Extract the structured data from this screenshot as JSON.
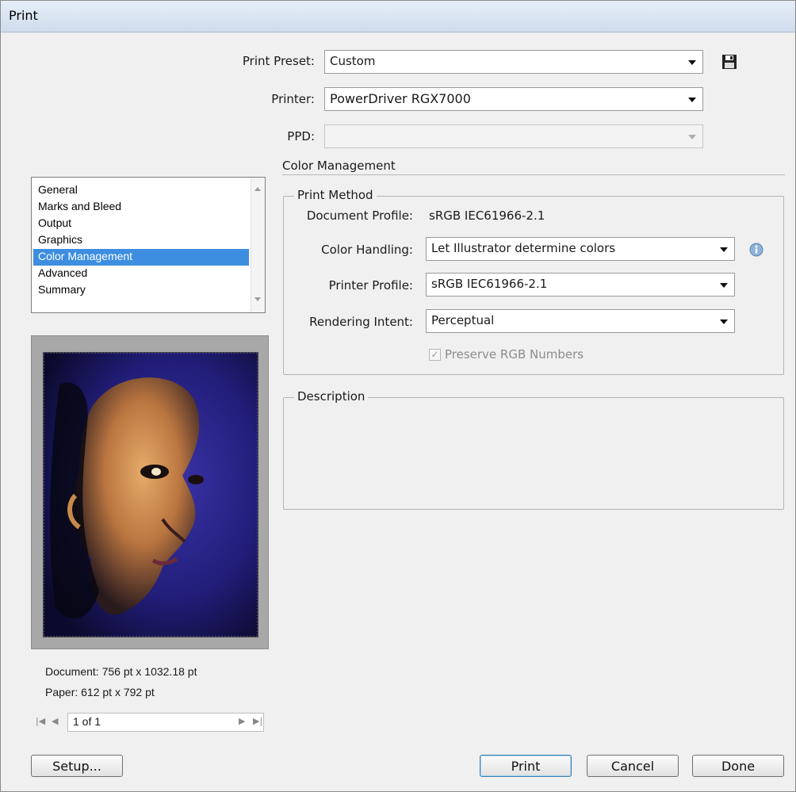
{
  "window": {
    "title": "Print"
  },
  "preset": {
    "label": "Print Preset:",
    "value": "Custom"
  },
  "printer": {
    "label": "Printer:",
    "value": "PowerDriver RGX7000"
  },
  "ppd": {
    "label": "PPD:",
    "value": ""
  },
  "section": {
    "title": "Color Management"
  },
  "print_method": {
    "legend": "Print Method",
    "doc_profile_label": "Document Profile:",
    "doc_profile_value": "sRGB IEC61966-2.1",
    "color_handling_label": "Color Handling:",
    "color_handling_value": "Let Illustrator determine colors",
    "printer_profile_label": "Printer Profile:",
    "printer_profile_value": "sRGB IEC61966-2.1",
    "rendering_intent_label": "Rendering Intent:",
    "rendering_intent_value": "Perceptual",
    "preserve_rgb_label": "Preserve RGB Numbers",
    "preserve_rgb_checked": true
  },
  "description": {
    "legend": "Description",
    "text": ""
  },
  "categories": {
    "items": [
      "General",
      "Marks and Bleed",
      "Output",
      "Graphics",
      "Color Management",
      "Advanced",
      "Summary"
    ],
    "selected": "Color Management"
  },
  "preview": {
    "document": "Document: 756 pt x 1032.18 pt",
    "paper": "Paper: 612 pt x 792 pt",
    "page": "1 of 1"
  },
  "buttons": {
    "setup": "Setup...",
    "print": "Print",
    "cancel": "Cancel",
    "done": "Done"
  },
  "colors": {
    "selection": "#3d8ee0",
    "artwork_bg": "#1c1a66",
    "artwork_skin": "#e4a25a"
  }
}
